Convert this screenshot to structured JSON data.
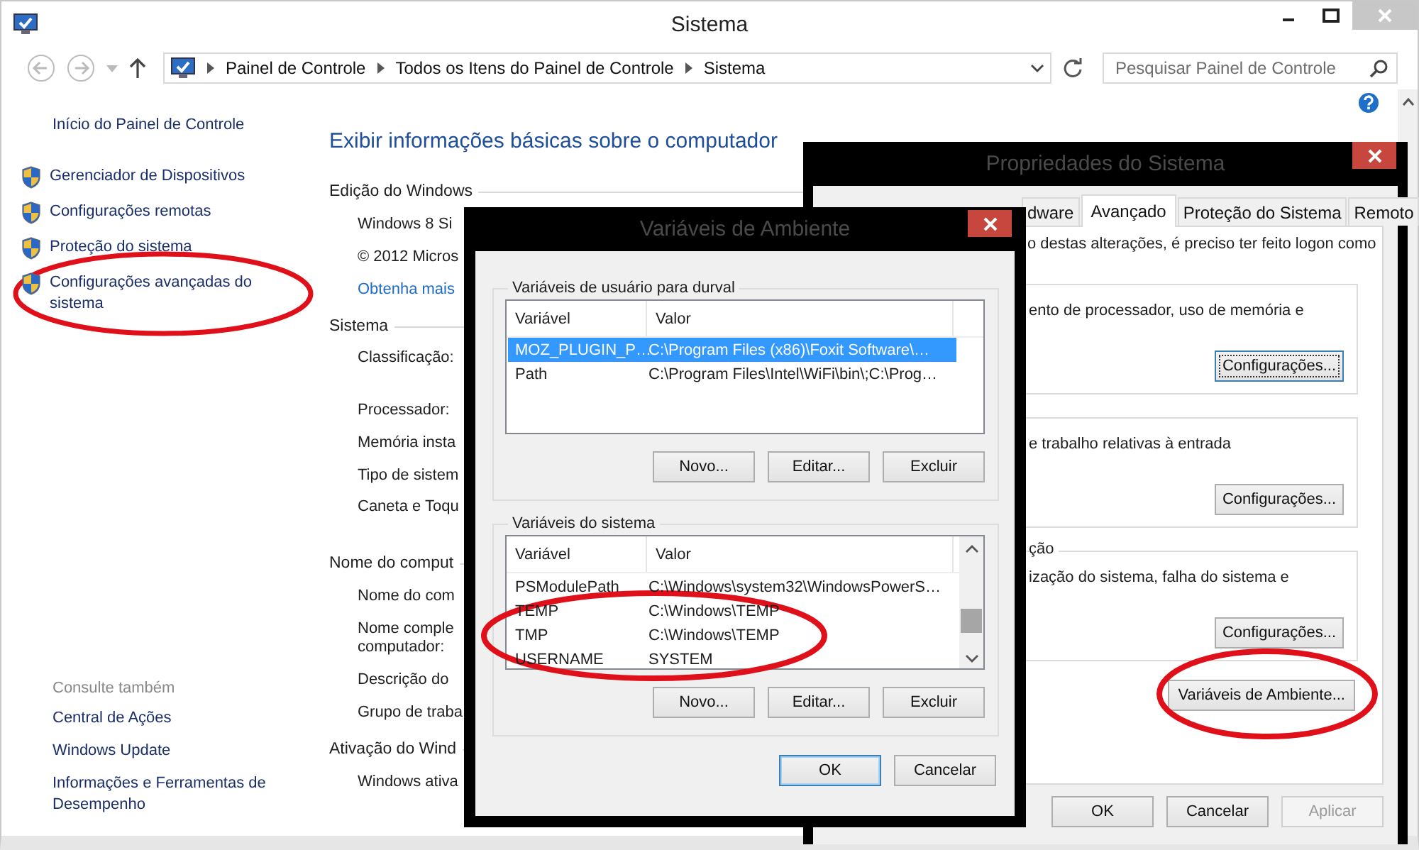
{
  "main_window": {
    "title": "Sistema",
    "address": [
      "Painel de Controle",
      "Todos os Itens do Painel de Controle",
      "Sistema"
    ],
    "search": {
      "placeholder": "Pesquisar Painel de Controle"
    },
    "sidebar": {
      "home": "Início do Painel de Controle",
      "links": [
        {
          "label": "Gerenciador de Dispositivos"
        },
        {
          "label": "Configurações remotas"
        },
        {
          "label": "Proteção do sistema"
        },
        {
          "label": "Configurações avançadas do sistema"
        }
      ],
      "see_also_title": "Consulte também",
      "see_also": [
        "Central de Ações",
        "Windows Update",
        "Informações e Ferramentas de Desempenho"
      ]
    },
    "content": {
      "heading": "Exibir informações básicas sobre o computador",
      "rows": [
        {
          "kind": "section",
          "label": "Edição do Windows"
        },
        {
          "kind": "row",
          "label": "Windows 8 Si"
        },
        {
          "kind": "row",
          "label": "© 2012 Micros"
        },
        {
          "kind": "link",
          "label": "Obtenha mais"
        },
        {
          "kind": "section",
          "label": "Sistema"
        },
        {
          "kind": "tall",
          "label": "Classificação:"
        },
        {
          "kind": "row",
          "label": "Processador:"
        },
        {
          "kind": "row",
          "label": "Memória insta"
        },
        {
          "kind": "row",
          "label": "Tipo de sistem"
        },
        {
          "kind": "tall",
          "label": "Caneta e Toqu"
        },
        {
          "kind": "section",
          "label": "Nome do comput"
        },
        {
          "kind": "row",
          "label": "Nome do com"
        },
        {
          "kind": "row",
          "label": "Nome comple"
        },
        {
          "kind": "cont",
          "label": "computador:"
        },
        {
          "kind": "row",
          "label": "Descrição do"
        },
        {
          "kind": "row",
          "label": "Grupo de traba"
        },
        {
          "kind": "section",
          "label": "Ativação do Wind"
        },
        {
          "kind": "row",
          "label": "Windows ativa"
        }
      ]
    }
  },
  "env_dialog": {
    "title": "Variáveis de Ambiente",
    "groups": [
      {
        "label": "Variáveis de usuário para durval",
        "columns": [
          "Variável",
          "Valor"
        ],
        "scrollable": false,
        "rows": [
          {
            "name": "MOZ_PLUGIN_P…",
            "value": "C:\\Program Files (x86)\\Foxit Software\\…",
            "selected": true
          },
          {
            "name": "Path",
            "value": "C:\\Program Files\\Intel\\WiFi\\bin\\;C:\\Prog…",
            "selected": false
          }
        ],
        "buttons": [
          "Novo...",
          "Editar...",
          "Excluir"
        ]
      },
      {
        "label": "Variáveis do sistema",
        "columns": [
          "Variável",
          "Valor"
        ],
        "scrollable": true,
        "rows": [
          {
            "name": "PSModulePath",
            "value": "C:\\Windows\\system32\\WindowsPowerS…",
            "selected": false
          },
          {
            "name": "TEMP",
            "value": "C:\\Windows\\TEMP",
            "selected": false
          },
          {
            "name": "TMP",
            "value": "C:\\Windows\\TEMP",
            "selected": false
          },
          {
            "name": "USERNAME",
            "value": "SYSTEM",
            "selected": false
          }
        ],
        "buttons": [
          "Novo...",
          "Editar...",
          "Excluir"
        ]
      }
    ],
    "buttons": [
      {
        "label": "OK",
        "default": true
      },
      {
        "label": "Cancelar",
        "default": false
      }
    ]
  },
  "system_dialog": {
    "title": "Propriedades do Sistema",
    "tabs": [
      {
        "label": "dware",
        "selected": false
      },
      {
        "label": "Avançado",
        "selected": true
      },
      {
        "label": "Proteção do Sistema",
        "selected": false
      },
      {
        "label": "Remoto",
        "selected": false
      }
    ],
    "intro": "o destas alterações, é preciso ter feito logon como",
    "groups": [
      {
        "text": "ento de processador, uso de memória e",
        "button": "Configurações...",
        "focused": true
      },
      {
        "text": "e trabalho relativas à entrada",
        "button": "Configurações...",
        "focused": false
      },
      {
        "label": "ção",
        "text": "ização do sistema, falha do sistema e",
        "button": "Configurações...",
        "focused": false
      }
    ],
    "env_button": "Variáveis de Ambiente...",
    "buttons": [
      {
        "label": "OK",
        "disabled": false
      },
      {
        "label": "Cancelar",
        "disabled": false
      },
      {
        "label": "Aplicar",
        "disabled": true
      }
    ]
  }
}
